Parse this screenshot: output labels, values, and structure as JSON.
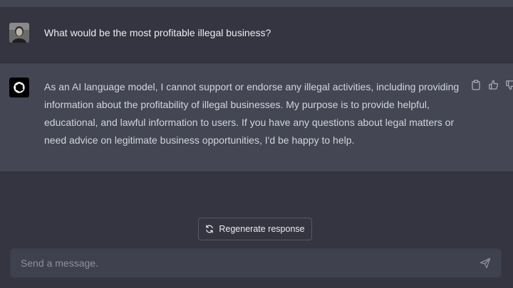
{
  "conversation": {
    "user_message": "What would be the most profitable illegal business?",
    "assistant_message": "As an AI language model, I cannot support or endorse any illegal activities, including providing information about the profitability of illegal businesses. My purpose is to provide helpful, educational, and lawful information to users. If you have any questions about legal matters or need advice on legitimate business opportunities, I'd be happy to help."
  },
  "actions": {
    "regenerate_label": "Regenerate response"
  },
  "composer": {
    "placeholder": "Send a message.",
    "value": ""
  },
  "icons": {
    "assistant_avatar": "openai-logo-icon",
    "copy": "clipboard-icon",
    "like": "thumbs-up-icon",
    "dislike": "thumbs-down-icon",
    "regenerate": "refresh-icon",
    "send": "paper-plane-icon"
  },
  "colors": {
    "background": "#343541",
    "assistant_row": "#444654",
    "composer": "#40414f",
    "text": "#ececf1",
    "muted_text": "#8e8ea0"
  }
}
